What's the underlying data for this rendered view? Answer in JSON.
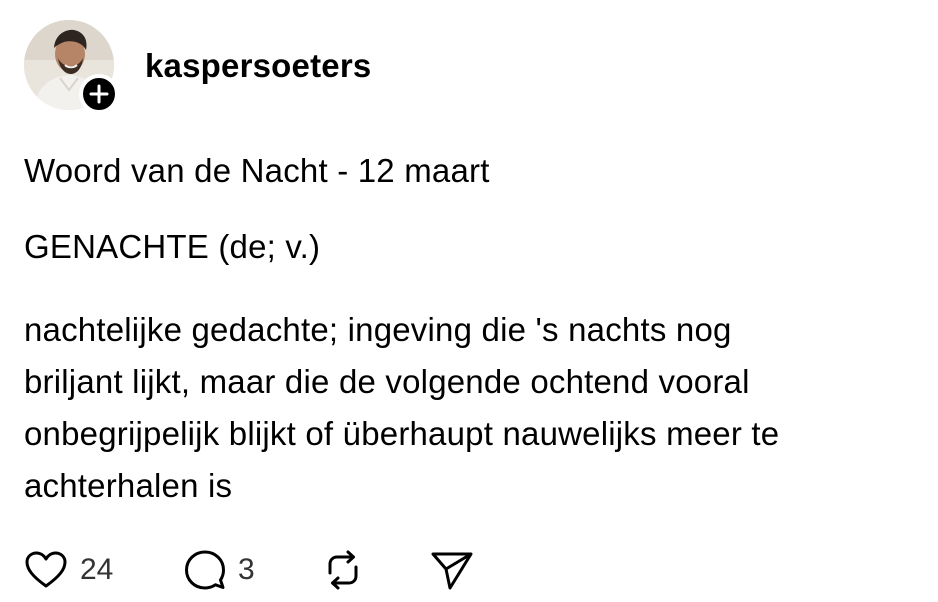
{
  "post": {
    "username": "kaspersoeters",
    "title": "Woord van de Nacht - 12 maart",
    "headword": "GENACHTE (de; v.)",
    "definition_lines": [
      "nachtelijke gedachte; ingeving die 's nachts nog",
      "briljant lijkt, maar die de volgende ochtend vooral",
      "onbegrijpelijk blijkt of überhaupt nauwelijks meer te",
      "achterhalen is"
    ],
    "actions": {
      "like": {
        "icon": "heart-icon",
        "count": "24"
      },
      "reply": {
        "icon": "comment-icon",
        "count": "3"
      },
      "repost": {
        "icon": "repost-icon"
      },
      "share": {
        "icon": "send-icon"
      }
    }
  },
  "colors": {
    "text": "#000000",
    "count_text": "#333333",
    "badge": "#000000",
    "background": "#ffffff"
  }
}
